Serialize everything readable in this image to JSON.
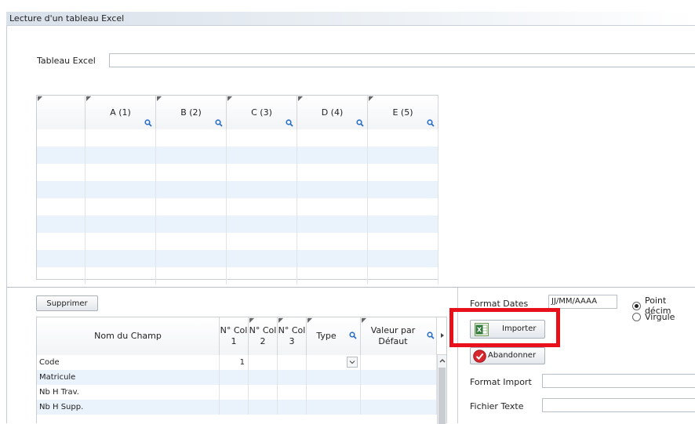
{
  "window": {
    "title": "Lecture d'un tableau Excel"
  },
  "file": {
    "label": "Tableau Excel",
    "value": ""
  },
  "excel_grid": {
    "columns": [
      "",
      "A (1)",
      "B (2)",
      "C (3)",
      "D (4)",
      "E (5)"
    ],
    "row_count": 9
  },
  "actions": {
    "supprimer": "Supprimer",
    "importer": "Importer",
    "abandonner": "Abandonner"
  },
  "mapping_grid": {
    "headers": {
      "nom": "Nom du Champ",
      "col1": "N° Col 1",
      "col2": "N° Col 2",
      "col3": "N° Col 3",
      "type": "Type",
      "valeur": "Valeur par Défaut"
    },
    "rows": [
      {
        "nom": "Code",
        "col1": "1",
        "col2": "",
        "col3": "",
        "type": "",
        "valeur": ""
      },
      {
        "nom": "Matricule",
        "col1": "",
        "col2": "",
        "col3": "",
        "type": "",
        "valeur": ""
      },
      {
        "nom": "Nb H Trav.",
        "col1": "",
        "col2": "",
        "col3": "",
        "type": "",
        "valeur": ""
      },
      {
        "nom": "Nb H Supp.",
        "col1": "",
        "col2": "",
        "col3": "",
        "type": "",
        "valeur": ""
      }
    ]
  },
  "settings": {
    "format_dates_label": "Format Dates",
    "format_dates_value": "JJ/MM/AAAA",
    "radio_point": "Point décim",
    "radio_virgule": "Virgule",
    "format_import_label": "Format Import",
    "format_import_value": "",
    "fichier_texte_label": "Fichier Texte",
    "fichier_texte_value": ""
  },
  "colors": {
    "highlight": "#e8101a",
    "row_alt": "#eaf3fc"
  },
  "icons": [
    "magnifier-icon",
    "excel-icon",
    "cancel-check-icon",
    "dropdown-chevron-icon",
    "scroll-up-icon",
    "column-nav-right-icon"
  ]
}
